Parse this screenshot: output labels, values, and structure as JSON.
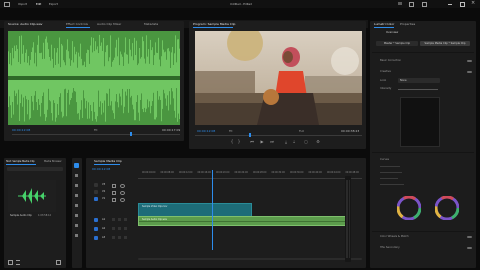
{
  "titlebar": {
    "menus": [
      "Import",
      "Edit",
      "Export"
    ],
    "center_title": "Untitled - Edited"
  },
  "source_panel": {
    "tabs": [
      "Source: Audio Clip.wav",
      "Effect Controls",
      "Audio Clip Mixer",
      "Metadata"
    ],
    "timecode_left": "00:00:12:08",
    "timecode_right": "00:00:17:09",
    "fit_label": "Fit"
  },
  "program_panel": {
    "tabs": [
      "Program: Sample Media Clip",
      "Program"
    ],
    "timecode_left": "00:00:12:08",
    "timecode_right": "00:00:38:23",
    "fit_label": "Fit",
    "quality_label": "Full"
  },
  "essential_panel": {
    "tabs": [
      "Lumetri Color",
      "Properties"
    ],
    "subtab": "Overview",
    "dropdown_master": "Master * Sample Clip",
    "dropdown_clip": "Sample Media Clip * Sample Clip",
    "sections": [
      "Basic Correction",
      "Creative",
      "Curves",
      "Color Wheels & Match",
      "HSL Secondary",
      "Vignette"
    ],
    "look_label": "Look",
    "none_value": "None",
    "intensity_label": "Intensity"
  },
  "project_panel": {
    "tabs": [
      "Text: Sample Media Clip",
      "Media Browser"
    ],
    "item_name": "Sample Audio Clip",
    "item_duration": "1:03:58:12",
    "item_meta": "48000 Hz - Stereo"
  },
  "timeline": {
    "tab": "Sample Media Clip",
    "timecode": "00:00:12:08",
    "ruler_labels": [
      "00:00:04:00",
      "00:00:08:00",
      "00:00:12:00",
      "00:00:16:00",
      "00:00:20:00",
      "00:00:24:00",
      "00:00:28:00",
      "00:00:32:00",
      "00:00:36:00",
      "00:00:40:00",
      "00:00:44:00",
      "00:00:48:00"
    ],
    "video_tracks": [
      "V3",
      "V2",
      "V1"
    ],
    "audio_tracks": [
      "A1",
      "A2",
      "A3"
    ],
    "video_clip_label": "Sample Video Clip.mov",
    "audio_clip_label": "Sample Audio Clip.wav",
    "playhead_fraction": 0.33
  },
  "colors": {
    "accent": "#2d8ceb",
    "waveform": "#6cc55a",
    "waveform_bg": "#4f9a43",
    "video_clip": "#1d6c78",
    "audio_clip": "#5c9c4c"
  }
}
